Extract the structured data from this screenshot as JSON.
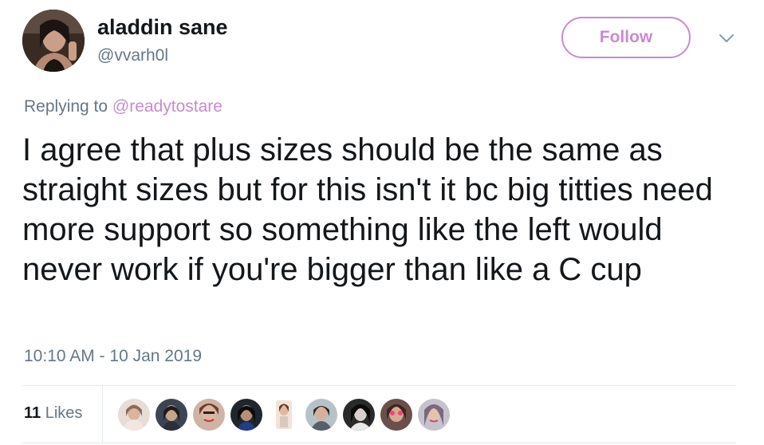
{
  "user": {
    "display_name": "aladdin sane",
    "handle": "@vvarh0l",
    "avatar_icon": "profile-photo"
  },
  "follow_button": {
    "label": "Follow",
    "accent_color": "#c78bd0"
  },
  "menu_icon": "chevron-down-icon",
  "reply": {
    "prefix": "Replying to ",
    "mention": "@readytostare"
  },
  "tweet": {
    "text": "I agree that plus sizes should be the same as straight sizes but for this isn't it bc big titties need more support so something like the left would never work if you're bigger than like a C cup"
  },
  "timestamp": "10:10 AM - 10 Jan 2019",
  "likes": {
    "count": "11",
    "label": " Likes",
    "liker_avatars": [
      {
        "icon": "liker-avatar",
        "color": "#d8c8c0"
      },
      {
        "icon": "liker-avatar",
        "color": "#3d4452"
      },
      {
        "icon": "liker-avatar",
        "color": "#c89c86"
      },
      {
        "icon": "liker-avatar",
        "color": "#20262e"
      },
      {
        "icon": "liker-avatar",
        "color": "#e2b9a0"
      },
      {
        "icon": "liker-avatar",
        "color": "#8a9da8"
      },
      {
        "icon": "liker-avatar",
        "color": "#2a2a2a"
      },
      {
        "icon": "liker-avatar",
        "color": "#a87c72"
      },
      {
        "icon": "liker-avatar",
        "color": "#b0a6b4"
      }
    ]
  }
}
